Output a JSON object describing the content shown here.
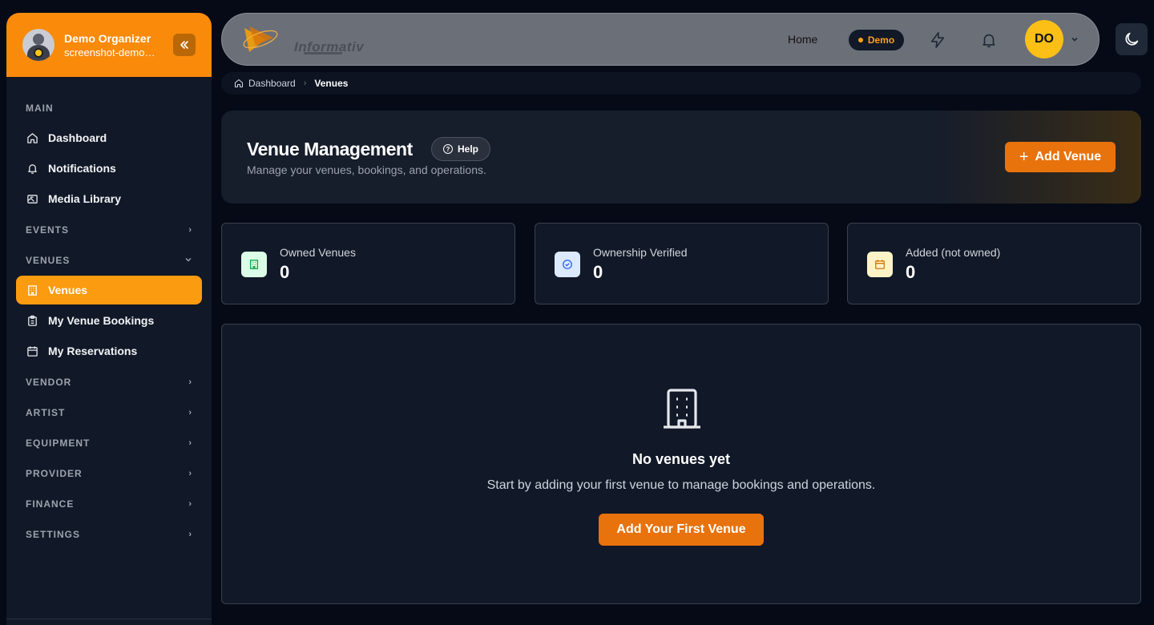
{
  "user": {
    "name": "Demo Organizer",
    "email": "screenshot-demo@i...",
    "initials": "DO"
  },
  "sidebar": {
    "sections": [
      {
        "label": "MAIN",
        "expanded": true,
        "items": [
          {
            "label": "Dashboard",
            "icon": "home-icon"
          },
          {
            "label": "Notifications",
            "icon": "bell-icon"
          },
          {
            "label": "Media Library",
            "icon": "image-icon"
          }
        ]
      },
      {
        "label": "EVENTS",
        "expanded": false
      },
      {
        "label": "VENUES",
        "expanded": true,
        "items": [
          {
            "label": "Venues",
            "icon": "building-icon",
            "active": true
          },
          {
            "label": "My Venue Bookings",
            "icon": "clipboard-icon"
          },
          {
            "label": "My Reservations",
            "icon": "calendar-icon"
          }
        ]
      },
      {
        "label": "VENDOR",
        "expanded": false
      },
      {
        "label": "ARTIST",
        "expanded": false
      },
      {
        "label": "EQUIPMENT",
        "expanded": false
      },
      {
        "label": "PROVIDER",
        "expanded": false
      },
      {
        "label": "FINANCE",
        "expanded": false
      },
      {
        "label": "SETTINGS",
        "expanded": false
      }
    ]
  },
  "topbar": {
    "logo_text": "Informativ",
    "home_label": "Home",
    "demo_label": "Demo"
  },
  "breadcrumb": {
    "home": "Dashboard",
    "current": "Venues"
  },
  "header": {
    "title": "Venue Management",
    "help_label": "Help",
    "subtitle": "Manage your venues, bookings, and operations.",
    "add_button": "Add Venue"
  },
  "stats": [
    {
      "label": "Owned Venues",
      "value": "0",
      "icon": "building-icon",
      "bg": "#dcfce7",
      "fg": "#16a34a"
    },
    {
      "label": "Ownership Verified",
      "value": "0",
      "icon": "check-circle-icon",
      "bg": "#dbeafe",
      "fg": "#2563eb"
    },
    {
      "label": "Added (not owned)",
      "value": "0",
      "icon": "calendar-icon",
      "bg": "#fef3c7",
      "fg": "#d97706"
    }
  ],
  "empty": {
    "title": "No venues yet",
    "description": "Start by adding your first venue to manage bookings and operations.",
    "button": "Add Your First Venue"
  },
  "colors": {
    "accent": "#e8720c",
    "sidebar_active": "#fb9b0f",
    "avatar": "#fbbf15"
  }
}
